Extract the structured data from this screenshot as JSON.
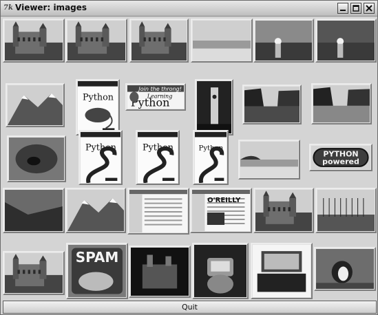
{
  "window": {
    "title": "Viewer: images",
    "tk_icon_glyph": "7k"
  },
  "titlebar_buttons": [
    "minimize",
    "maximize",
    "close"
  ],
  "thumbnails": [
    [
      {
        "name": "thumb-castle-tower",
        "subject": "stone castle with towers",
        "style": "photo-gothic"
      },
      {
        "name": "thumb-castle-hill",
        "subject": "castle on hill with trees",
        "style": "photo-castle"
      },
      {
        "name": "thumb-abbey",
        "subject": "abbey building under sky",
        "style": "photo-abbey"
      },
      {
        "name": "thumb-beach-sand",
        "subject": "sandy beach with surf",
        "style": "photo-beach"
      },
      {
        "name": "thumb-sunset-sea",
        "subject": "sunset over sea",
        "style": "photo-sunset"
      },
      {
        "name": "thumb-sunset-shore",
        "subject": "sun reflecting on shore",
        "style": "photo-sunset2"
      }
    ],
    [
      {
        "name": "thumb-snow-mountain",
        "subject": "snowy mountain ridge",
        "style": "photo-mountain"
      },
      {
        "name": "thumb-programming-python-cover-1",
        "subject": "Programming Python book cover",
        "style": "book-rat",
        "label": "Python"
      },
      {
        "name": "thumb-learning-python-cover",
        "subject": "Learning Python book cover",
        "style": "book-learning",
        "label": "Learning Python",
        "tagline": "Join the throng!"
      },
      {
        "name": "thumb-clock-tower",
        "subject": "clock tower at night",
        "style": "photo-tower"
      },
      {
        "name": "thumb-lake-trees",
        "subject": "lake with trees",
        "style": "photo-lake"
      },
      {
        "name": "thumb-street-row",
        "subject": "row of houses on street",
        "style": "photo-street"
      }
    ],
    [
      {
        "name": "thumb-cave-animal",
        "subject": "animal in cave",
        "style": "photo-cave"
      },
      {
        "name": "thumb-programming-python-cover-2",
        "subject": "Programming Python book cover",
        "style": "book-snake",
        "label": "Python"
      },
      {
        "name": "thumb-programming-python-cover-3",
        "subject": "Programming Python book cover",
        "style": "book-snake",
        "label": "Python"
      },
      {
        "name": "thumb-programming-python-cover-4",
        "subject": "Programming Python book cover",
        "style": "book-snake",
        "label": "Python"
      },
      {
        "name": "thumb-tropical-beach",
        "subject": "tropical beach with palms",
        "style": "photo-tropical"
      },
      {
        "name": "thumb-python-powered-logo",
        "subject": "Python Powered logo",
        "style": "logo",
        "label": "PYTHON",
        "label2": "powered"
      }
    ],
    [
      {
        "name": "thumb-rocky-forest",
        "subject": "rocky forest slope",
        "style": "photo-forest"
      },
      {
        "name": "thumb-alpine-range",
        "subject": "alpine mountain range",
        "style": "photo-alps"
      },
      {
        "name": "thumb-web-page-screenshot",
        "subject": "web page screenshot",
        "style": "screen-web"
      },
      {
        "name": "thumb-oreilly-site-screenshot",
        "subject": "O'Reilly web site screenshot",
        "style": "screen-oreilly",
        "label": "O'REILLY"
      },
      {
        "name": "thumb-cathedral-spires",
        "subject": "cathedral with spires",
        "style": "photo-cathedral"
      },
      {
        "name": "thumb-harbor-boats",
        "subject": "harbor with sailboats",
        "style": "photo-harbor"
      }
    ],
    [
      {
        "name": "thumb-ornate-palace",
        "subject": "ornate palace",
        "style": "photo-palace"
      },
      {
        "name": "thumb-spam-can",
        "subject": "Spam can",
        "style": "spam",
        "label": "SPAM"
      },
      {
        "name": "thumb-castle-night",
        "subject": "castle lit at night",
        "style": "photo-night"
      },
      {
        "name": "thumb-handheld-pc",
        "subject": "hand holding handheld computer",
        "style": "photo-hand"
      },
      {
        "name": "thumb-laptop-keyboard",
        "subject": "small laptop with keyboard",
        "style": "photo-laptop"
      },
      {
        "name": "thumb-penguin-bird",
        "subject": "penguin on rocks",
        "style": "photo-penguin"
      }
    ]
  ],
  "quit_button": {
    "label": "Quit"
  }
}
